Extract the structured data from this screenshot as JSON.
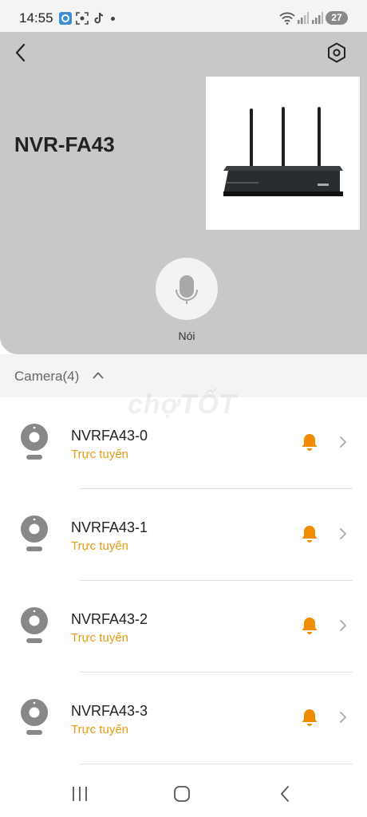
{
  "status_bar": {
    "time": "14:55",
    "battery": "27"
  },
  "header": {
    "device_name": "NVR-FA43",
    "mic_label": "Nói"
  },
  "section": {
    "title": "Camera(4)"
  },
  "watermark": "chợTỐT",
  "cameras": [
    {
      "name": "NVRFA43-0",
      "status": "Trực tuyến"
    },
    {
      "name": "NVRFA43-1",
      "status": "Trực tuyến"
    },
    {
      "name": "NVRFA43-2",
      "status": "Trực tuyến"
    },
    {
      "name": "NVRFA43-3",
      "status": "Trực tuyến"
    }
  ],
  "colors": {
    "header_bg": "#c8c8c8",
    "status_online": "#e89b10",
    "bell": "#f08c00"
  },
  "icons": [
    "back-arrow-icon",
    "settings-hexagon-icon",
    "microphone-icon",
    "chevron-up-icon",
    "camera-icon",
    "bell-icon",
    "chevron-right-icon",
    "nav-recents-icon",
    "nav-home-icon",
    "nav-back-icon"
  ]
}
